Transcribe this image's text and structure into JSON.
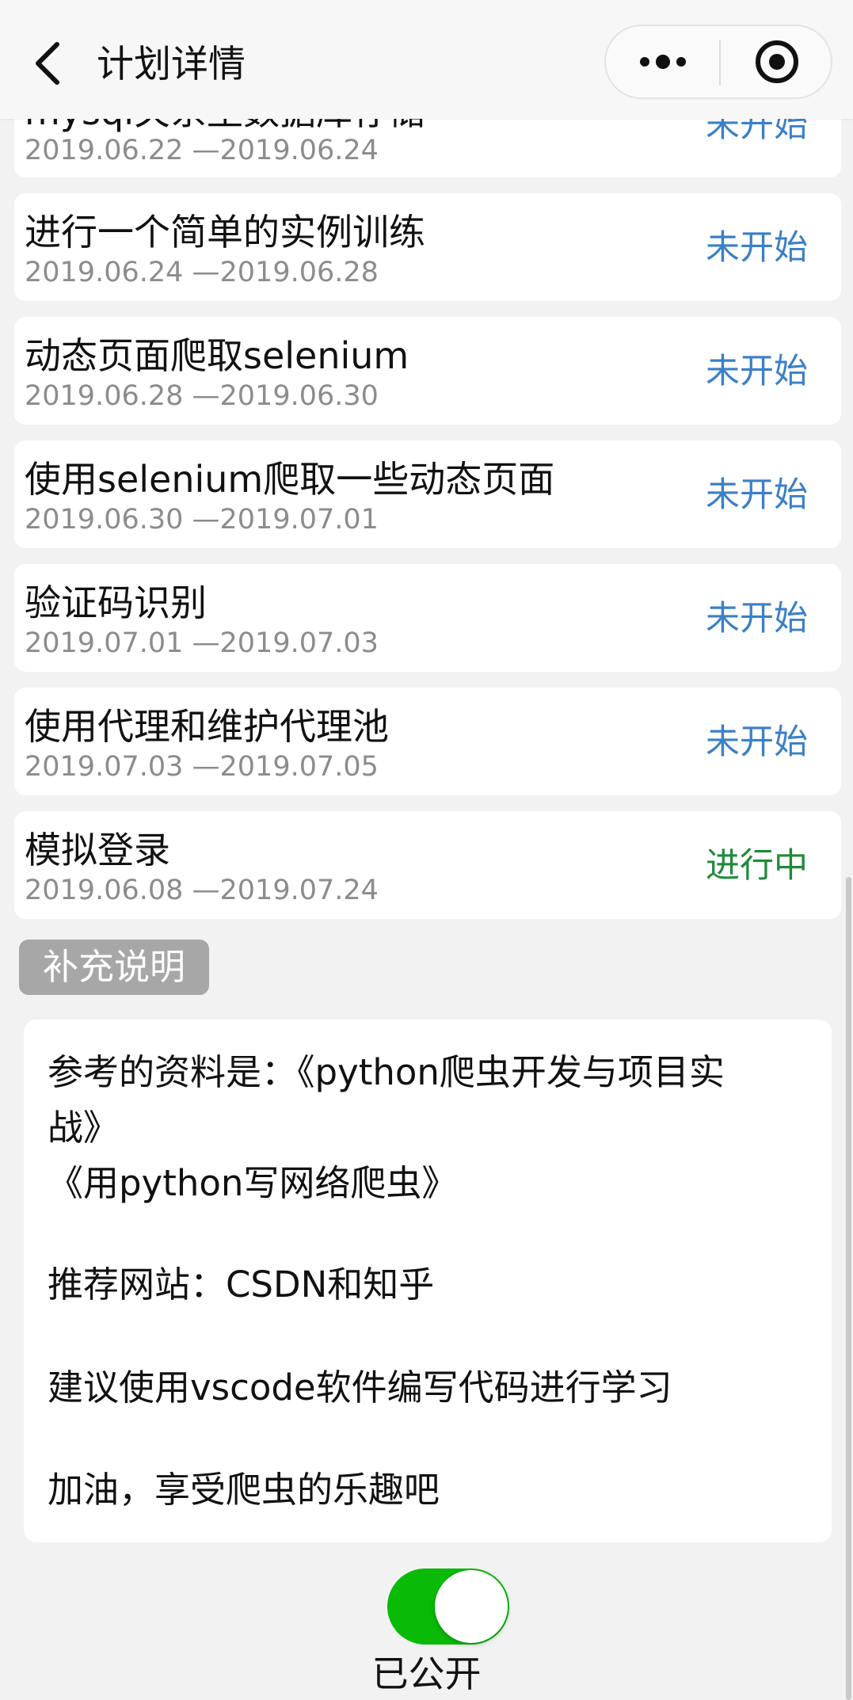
{
  "header": {
    "title": "计划详情"
  },
  "tasks": [
    {
      "name": "mysql关系型数据库存储",
      "dates": "2019.06.22 —2019.06.24",
      "status": "未开始"
    },
    {
      "name": "进行一个简单的实例训练",
      "dates": "2019.06.24 —2019.06.28",
      "status": "未开始"
    },
    {
      "name": "动态页面爬取selenium",
      "dates": "2019.06.28 —2019.06.30",
      "status": "未开始"
    },
    {
      "name": "使用selenium爬取一些动态页面",
      "dates": "2019.06.30 —2019.07.01",
      "status": "未开始"
    },
    {
      "name": "验证码识别",
      "dates": "2019.07.01 —2019.07.03",
      "status": "未开始"
    },
    {
      "name": "使用代理和维护代理池",
      "dates": "2019.07.03 —2019.07.05",
      "status": "未开始"
    },
    {
      "name": "模拟登录",
      "dates": "2019.06.08 —2019.07.24",
      "status": "进行中"
    }
  ],
  "supplement": {
    "tag_label": "补充说明",
    "lines": [
      "参考的资料是：《python爬虫开发与项目实",
      "战》",
      "《用python写网络爬虫》",
      "推荐网站：CSDN和知乎",
      "建议使用vscode软件编写代码进行学习",
      "加油，享受爬虫的乐趣吧"
    ]
  },
  "toggle": {
    "label": "已公开",
    "on": true
  },
  "colors": {
    "pending": "#3b7fc7",
    "active": "#1f8a3a",
    "toggle_on": "#09bb07"
  }
}
